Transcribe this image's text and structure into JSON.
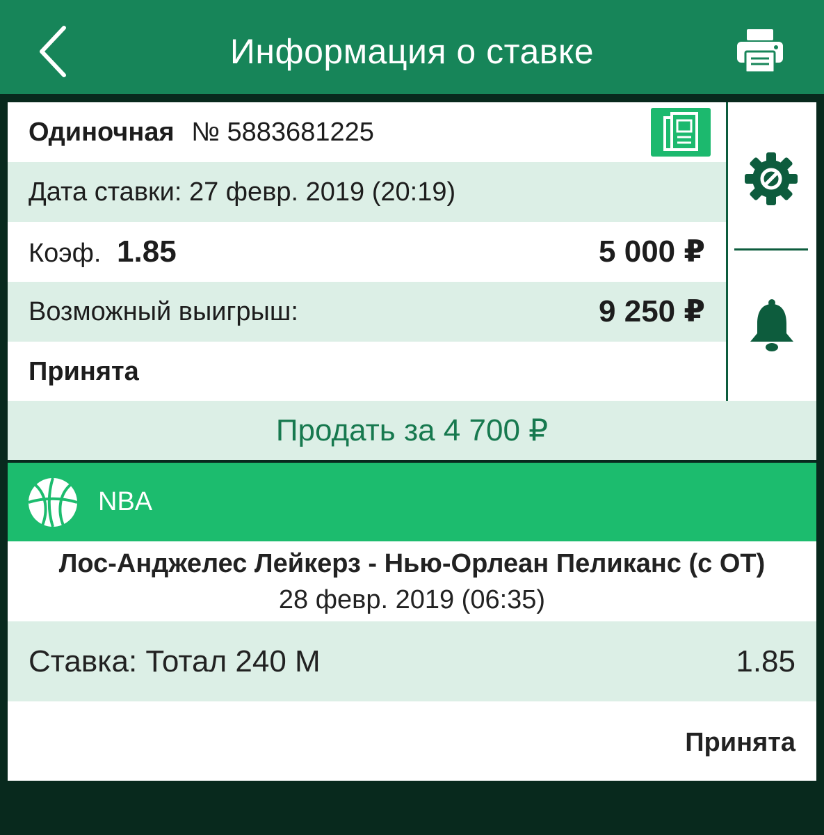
{
  "header": {
    "title": "Информация о ставке",
    "back_icon": "chevron-left-icon",
    "print_icon": "printer-icon"
  },
  "bet": {
    "type": "Одиночная",
    "number": "№ 5883681225",
    "date": "Дата ставки: 27 февр. 2019 (20:19)",
    "coef_label": "Коэф.",
    "coef_value": "1.85",
    "stake": "5 000 ₽",
    "win_label": "Возможный выигрыш:",
    "win_value": "9 250 ₽",
    "status": "Принята"
  },
  "side_actions": {
    "settings_icon": "gear-icon",
    "notify_icon": "bell-icon"
  },
  "sell_button": "Продать за 4 700 ₽",
  "event": {
    "league": "NBA",
    "league_icon": "basketball-icon",
    "match": "Лос-Анджелес Лейкерз - Нью-Орлеан Пеликанс (с ОТ)",
    "datetime": "28 февр. 2019 (06:35)",
    "pick": "Ставка: Тотал 240 М",
    "pick_coef": "1.85",
    "status": "Принята"
  },
  "colors": {
    "header_green": "#178559",
    "accent_green": "#1cbc6e",
    "light_row": "#dcefe6",
    "dark_bg": "#08291d",
    "sell_text": "#17794f"
  }
}
